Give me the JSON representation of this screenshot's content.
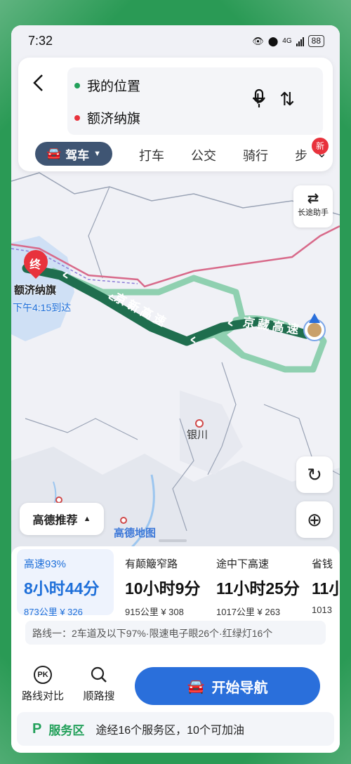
{
  "status_bar": {
    "time": "7:32",
    "network": "4G",
    "battery": "88"
  },
  "search": {
    "back_icon": "back-arrow-icon",
    "start": "我的位置",
    "end": "额济纳旗",
    "start_dot_color": "#22a05a",
    "end_dot_color": "#e8323c"
  },
  "modes": {
    "active": "驾车",
    "items": [
      "打车",
      "公交",
      "骑行",
      "步"
    ],
    "new_badge": "新"
  },
  "long_trip": {
    "label": "长途助手"
  },
  "map": {
    "end_marker": "终",
    "destination": "额济纳旗",
    "eta": "下午4:15到达",
    "city": "银川",
    "road1": "京新高速",
    "road2": "京藏高速",
    "recommend": "高德推荐",
    "logo": "高德地图"
  },
  "routes": [
    {
      "tag": "高速93%",
      "time": "8小时44分",
      "distance": "873公里",
      "cost": "¥ 326",
      "active": true
    },
    {
      "tag": "有颠簸窄路",
      "time": "10小时9分",
      "distance": "915公里",
      "cost": "¥ 308"
    },
    {
      "tag": "途中下高速",
      "time": "11小时25分",
      "distance": "1017公里",
      "cost": "¥ 263"
    },
    {
      "tag": "省钱",
      "time": "11小",
      "distance": "1013",
      "cost": ""
    }
  ],
  "route_desc": "路线一：2车道及以下97%·限速电子眼26个·红绿灯16个",
  "actions": {
    "compare": "路线对比",
    "compare_icon_text": "PK",
    "along_search": "顺路搜",
    "start_nav": "开始导航"
  },
  "service": {
    "icon_text": "P",
    "title": "服务区",
    "text": "途经16个服务区，10个可加油"
  },
  "colors": {
    "route_main": "#1f6e4e",
    "route_alt": "#8fd0b0",
    "accent_blue": "#2a6fdb",
    "border_line": "#d86a8a"
  }
}
